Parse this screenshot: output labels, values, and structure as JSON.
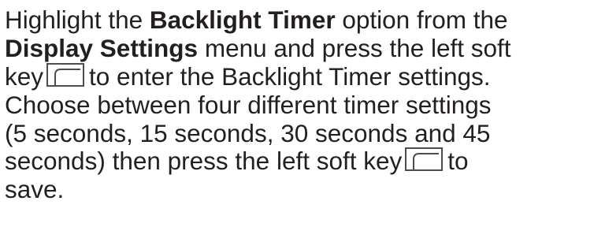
{
  "instruction": {
    "line1": {
      "text_a": "Highlight the ",
      "bold_a": "Backlight Timer",
      "text_b": " option from the"
    },
    "line2": {
      "bold_a": "Display Settings",
      "text_a": " menu and press the left soft"
    },
    "line3": {
      "text_a": "key",
      "icon": "left-soft-key-icon",
      "text_b": "to enter the Backlight Timer settings."
    },
    "line4": {
      "text_a": "Choose between four different timer settings"
    },
    "line5": {
      "text_a": "(5 seconds, 15 seconds, 30 seconds and 45"
    },
    "line6": {
      "text_a": "seconds)  then press the left soft key",
      "icon": "left-soft-key-icon",
      "text_b": "to"
    },
    "line7": {
      "text_a": "save."
    }
  },
  "colors": {
    "text": "#231f20",
    "icon_stroke": "#4d4d4f",
    "background": "#ffffff"
  }
}
